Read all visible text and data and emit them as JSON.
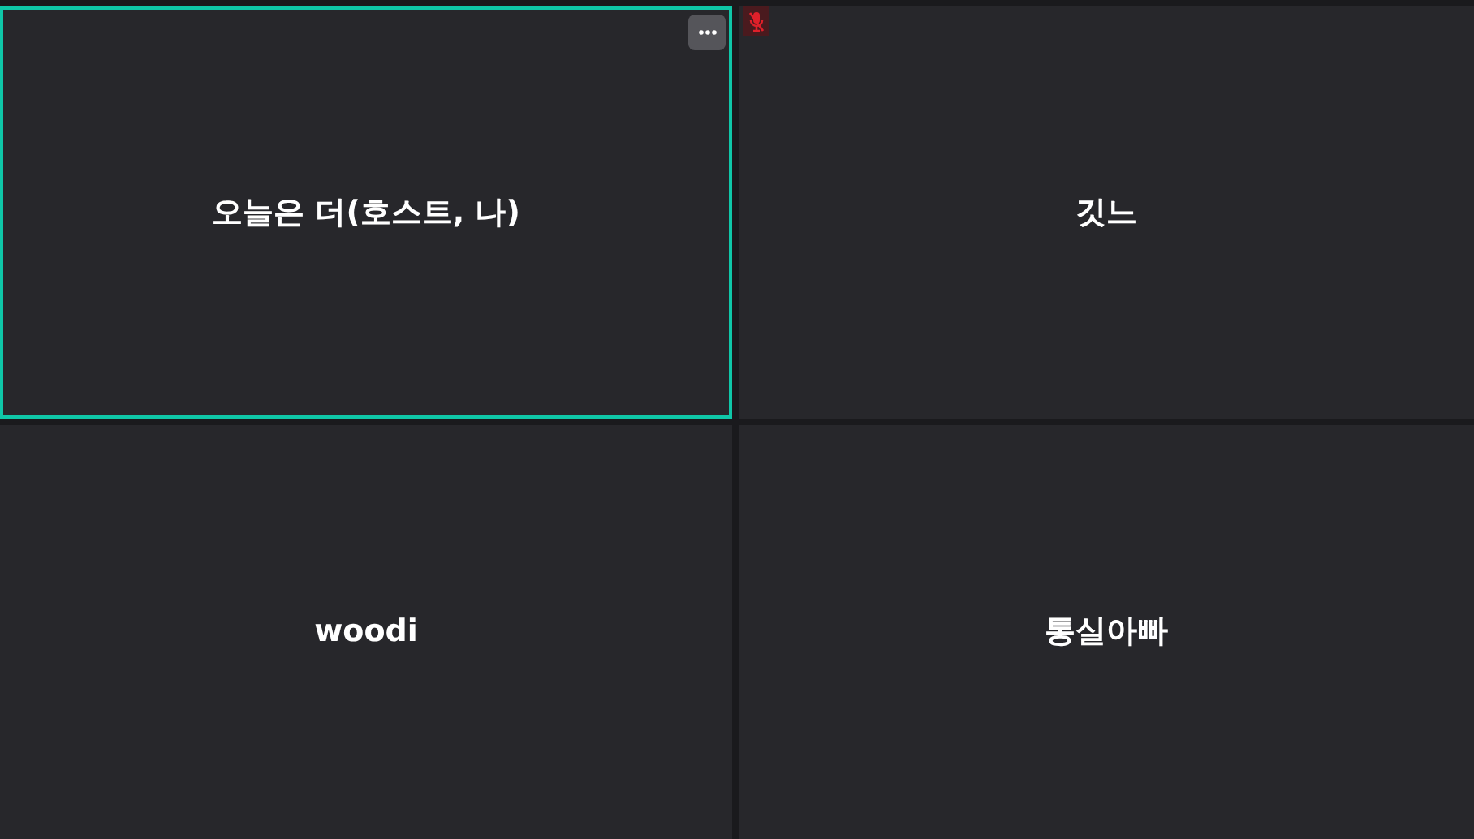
{
  "tiles": [
    {
      "name": "오늘은 더(호스트, 나)",
      "speaking": true,
      "muted": false,
      "menu_button": true
    },
    {
      "name": "깃느",
      "speaking": false,
      "muted": true,
      "menu_button": false
    },
    {
      "name": "woodi",
      "speaking": false,
      "muted": false,
      "menu_button": false
    },
    {
      "name": "통실아빠",
      "speaking": false,
      "muted": false,
      "menu_button": false
    }
  ]
}
